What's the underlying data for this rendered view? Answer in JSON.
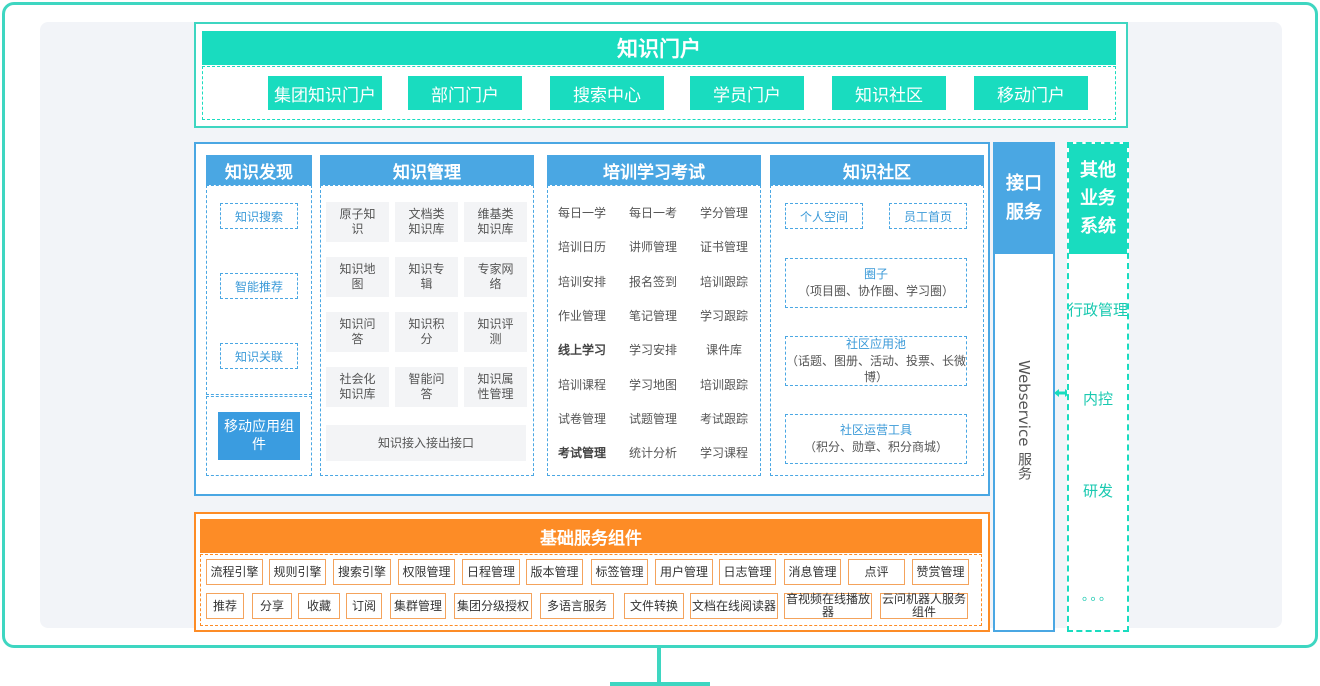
{
  "portal": {
    "title": "知识门户",
    "items": [
      "集团知识门户",
      "部门门户",
      "搜索中心",
      "学员门户",
      "知识社区",
      "移动门户"
    ]
  },
  "discovery": {
    "title": "知识发现",
    "items": [
      "知识搜索",
      "智能推荐",
      "知识关联"
    ],
    "mobile": "移动应用组件"
  },
  "management": {
    "title": "知识管理",
    "cells": [
      "原子知识",
      "文档类知识库",
      "维基类知识库",
      "知识地图",
      "知识专辑",
      "专家网络",
      "知识问答",
      "知识积分",
      "知识评测",
      "社会化知识库",
      "智能问答",
      "知识属性管理"
    ],
    "bottom": "知识接入接出接口"
  },
  "training": {
    "title": "培训学习考试",
    "cells": [
      "每日一学",
      "每日一考",
      "学分管理",
      "培训日历",
      "讲师管理",
      "证书管理",
      "培训安排",
      "报名签到",
      "培训跟踪",
      "作业管理",
      "笔记管理",
      "学习跟踪",
      "线上学习",
      "学习安排",
      "课件库",
      "培训课程",
      "学习地图",
      "培训跟踪",
      "试卷管理",
      "试题管理",
      "考试跟踪",
      "考试管理",
      "统计分析",
      "学习课程"
    ]
  },
  "community": {
    "title": "知识社区",
    "top": [
      "个人空间",
      "员工首页"
    ],
    "boxes": [
      {
        "title": "圈子",
        "sub": "（项目圈、协作圈、学习圈）"
      },
      {
        "title": "社区应用池",
        "sub": "（话题、图册、活动、投票、长微博）"
      },
      {
        "title": "社区运营工具",
        "sub": "（积分、勋章、积分商城）"
      }
    ]
  },
  "interface": {
    "title": "接口服务",
    "vertical": "Webservice",
    "suffix": "服务"
  },
  "other": {
    "title": "其他业务系统",
    "items": [
      "行政管理",
      "内控",
      "研发",
      "。。。"
    ]
  },
  "basic": {
    "title": "基础服务组件",
    "row1": [
      "流程引擎",
      "规则引擎",
      "搜索引擎",
      "权限管理",
      "日程管理",
      "版本管理",
      "标签管理",
      "用户管理",
      "日志管理",
      "消息管理",
      "点评",
      "赞赏管理"
    ],
    "row2": [
      "推荐",
      "分享",
      "收藏",
      "订阅",
      "集群管理",
      "集团分级授权",
      "多语言服务",
      "文件转换",
      "文档在线阅读器",
      "音视频在线播放器",
      "云问机器人服务组件"
    ]
  },
  "colors": {
    "teal": "#19dcbf",
    "blue": "#4aa7e3",
    "orange": "#fd8c26"
  }
}
